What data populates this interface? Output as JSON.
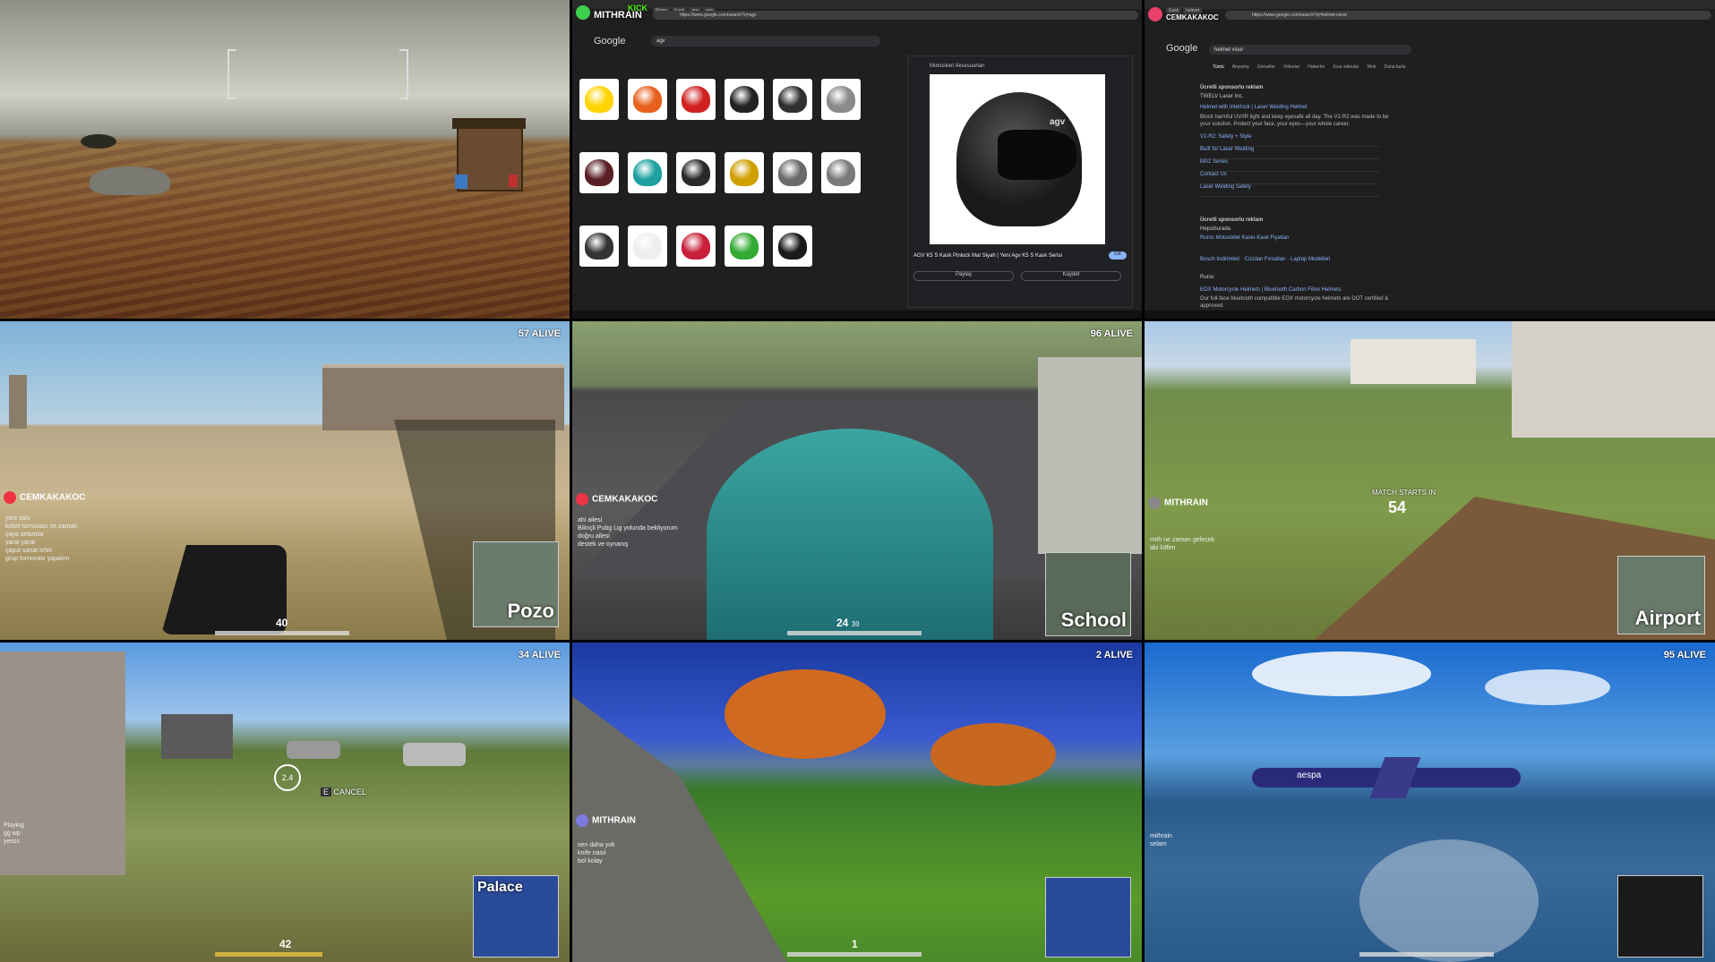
{
  "tile1": {
    "kind": "game-landscape"
  },
  "tile2": {
    "channel_label": "KICK",
    "streamer": "MITHRAIN",
    "google_logo": "Google",
    "search_query": "agv",
    "panel_source": "Motosiklet Aksesuarları",
    "panel_title": "AGV K5 S Kask Pinlock Mat Siyah | Yeni Agv K5 S Kask Serisi",
    "visit_button": "Git",
    "share_button": "Paylaş",
    "save_button": "Kaydet",
    "brand_text": "agv",
    "helmet_colors": [
      "#ffd400",
      "#e8601c",
      "#d02020",
      "#222222",
      "#303030",
      "#8a8a8a",
      "#5a1f25",
      "#1ea0a0",
      "#2a2a2a",
      "#d0a000",
      "#6a6a6a",
      "#7a7a7a",
      "#333333",
      "#eeeeee",
      "#c8203a",
      "#33aa33",
      "#1a1a1a"
    ]
  },
  "tile3": {
    "streamer": "CEMKAKAKOC",
    "google_logo": "Google",
    "search_query": "helmet visor",
    "tabs": [
      "Tümü",
      "Alışveriş",
      "Görseller",
      "Videolar",
      "Haberler",
      "Kısa videolar",
      "Web",
      "Daha fazla"
    ],
    "sponsored_label": "Ücretli sponsorlu reklam",
    "ad1": {
      "source": "TWELV Laser Inc.",
      "title": "Helmet with Interlock | Laser Welding Helmet",
      "desc": "Block harmful UV/IR light and keep eyesafe all day. The V2-R2 was made to be your solution. Protect your face, your eyes—your whole career."
    },
    "sitelinks": [
      "V2-R2: Safety + Style",
      "Built for Laser Welding",
      "MA1 Series",
      "Contact Us",
      "Laser Welding Safety"
    ],
    "ad2": {
      "source": "Hepsiburada",
      "title": "Ruroc Motosiklet Kaskı-Kask Fiyatları",
      "links": "Bosch Indirimleri · Cüzdan Fırsatları · Laptop Modelleri"
    },
    "ad3": {
      "source": "Ruroc",
      "title": "EOX Motorcycle Helmets | Bluetooth Carbon Fibre Helmets",
      "desc": "Our full-face bluetooth compatible EOX motorcycle helmets are DOT certified & approved."
    }
  },
  "tile4": {
    "alive": "57 ALIVE",
    "streamer": "CEMKAKAKOC",
    "ammo": "40",
    "map_name": "Pozo",
    "chat": [
      [
        "yeni sahi"
      ],
      [
        "kobel turnuvası ne zaman"
      ],
      [
        "çaya selamlar"
      ],
      [
        "yarat yarat"
      ],
      [
        "çaput sanat ichin"
      ],
      [
        "grup turnuvası yapalım"
      ]
    ]
  },
  "tile5": {
    "alive": "96 ALIVE",
    "streamer": "CEMKAKAKOC",
    "ammo": "24",
    "ammo_reserve": "30",
    "map_name": "School",
    "chat": [
      [
        "ahi ailesi"
      ],
      [
        "Bilinçli Pubg Lig yolunda bekliyorum"
      ],
      [
        "doğru ailesi"
      ],
      [
        "destek ve oynanış"
      ]
    ]
  },
  "tile6": {
    "streamer": "MITHRAIN",
    "countdown_label": "MATCH STARTS IN",
    "countdown": "54",
    "map_name": "Airport",
    "chat": [
      [
        "mith ne zaman gelecek"
      ],
      [
        "abi lütfen"
      ]
    ]
  },
  "tile7": {
    "alive": "34 ALIVE",
    "ammo": "42",
    "revive_time": "2.4",
    "cancel_label": "CANCEL",
    "map_name": "Palace",
    "chat": [
      [
        "Playing"
      ],
      [
        "gg wp"
      ],
      [
        "yesss"
      ]
    ]
  },
  "tile8": {
    "alive": "2 ALIVE",
    "streamer": "MITHRAIN",
    "ammo": "1",
    "chat": [
      [
        "sen daha yok"
      ],
      [
        "knife nasıl"
      ],
      [
        "bol kolay"
      ]
    ]
  },
  "tile9": {
    "alive": "95 ALIVE",
    "plane_text": "aespa",
    "chat": [
      [
        "mithrain"
      ],
      [
        "selam"
      ]
    ]
  }
}
